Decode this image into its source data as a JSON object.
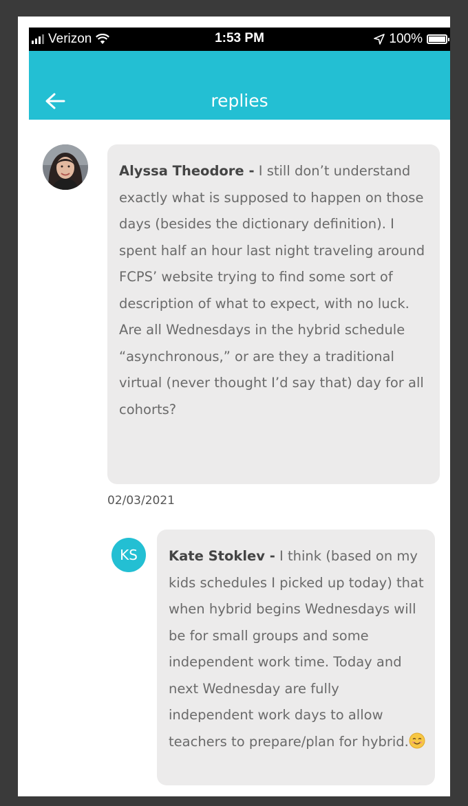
{
  "status_bar": {
    "carrier": "Verizon",
    "time": "1:53 PM",
    "battery": "100%"
  },
  "header": {
    "title": "replies",
    "back_icon": "arrow-left-icon"
  },
  "colors": {
    "accent": "#23bfd3",
    "bubble": "#ecebeb"
  },
  "post": {
    "author": "Alyssa Theodore -",
    "text": " I still don’t understand exactly what is supposed to happen on those days (besides the dictionary definition). I spent half an hour last night traveling around FCPS’ website trying to find some sort of description of what to expect, with no luck. Are all Wednesdays in the hybrid schedule “asynchronous,” or are they a traditional virtual (never thought I’d say that) day for all cohorts?",
    "date": "02/03/2021"
  },
  "reply": {
    "initials": "KS",
    "author": "Kate Stoklev -",
    "text": "  I think (based on my kids schedules I picked up today) that when hybrid begins Wednesdays will be for small groups and some independent work time. Today and next Wednesday are fully independent work days to allow teachers to prepare/plan for hybrid.",
    "emoji": "smiling-face-icon"
  }
}
